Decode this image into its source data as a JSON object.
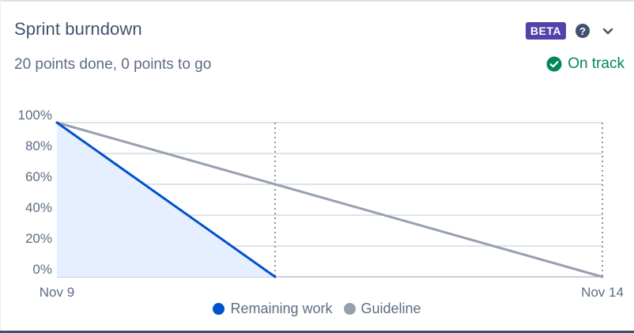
{
  "header": {
    "title": "Sprint burndown",
    "badge": "BETA",
    "help_icon": "help-circle-icon",
    "menu_icon": "chevron-down-icon"
  },
  "summary": {
    "text": "20 points done, 0 points to go",
    "status": "On track",
    "status_icon": "check-circle-icon"
  },
  "colors": {
    "accent_remaining": "#0052cc",
    "fill_remaining": "#e6efff",
    "guideline": "#97a0af",
    "status_green": "#00875a",
    "badge_purple": "#5243aa"
  },
  "chart_data": {
    "type": "line",
    "x_tick_labels": [
      "Nov 9",
      "Nov 14"
    ],
    "y_tick_labels": [
      "100%",
      "80%",
      "60%",
      "40%",
      "20%",
      "0%"
    ],
    "ylim": [
      0,
      100
    ],
    "grid": true,
    "legend_position": "bottom",
    "series": [
      {
        "name": "Remaining work",
        "points": [
          {
            "x": 0,
            "y": 100
          },
          {
            "x": 2,
            "y": 0
          }
        ]
      },
      {
        "name": "Guideline",
        "points": [
          {
            "x": 0,
            "y": 100
          },
          {
            "x": 5,
            "y": 0
          }
        ]
      }
    ],
    "reference_lines_x": [
      2,
      5
    ]
  }
}
